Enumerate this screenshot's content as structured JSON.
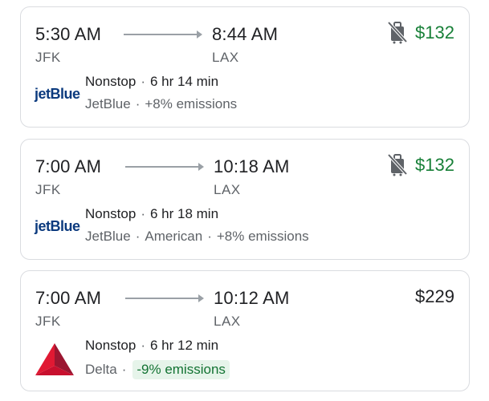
{
  "flights": [
    {
      "depart_time": "5:30 AM",
      "arrive_time": "8:44 AM",
      "from": "JFK",
      "to": "LAX",
      "stops": "Nonstop",
      "duration": "6 hr 14 min",
      "airlines": "JetBlue",
      "emissions": "+8% emissions",
      "price": "$132",
      "price_color": "#188038",
      "logo_text": "jetBlue",
      "no_carry_on_icon": "no-bag-icon"
    },
    {
      "depart_time": "7:00 AM",
      "arrive_time": "10:18 AM",
      "from": "JFK",
      "to": "LAX",
      "stops": "Nonstop",
      "duration": "6 hr 18 min",
      "airlines": "JetBlue",
      "airlines_2": "American",
      "emissions": "+8% emissions",
      "price": "$132",
      "price_color": "#188038",
      "logo_text": "jetBlue",
      "no_carry_on_icon": "no-bag-icon"
    },
    {
      "depart_time": "7:00 AM",
      "arrive_time": "10:12 AM",
      "from": "JFK",
      "to": "LAX",
      "stops": "Nonstop",
      "duration": "6 hr 12 min",
      "airlines": "Delta",
      "emissions": "-9% emissions",
      "price": "$229",
      "price_color": "#202124",
      "logo_icon": "delta-logo-icon"
    }
  ]
}
